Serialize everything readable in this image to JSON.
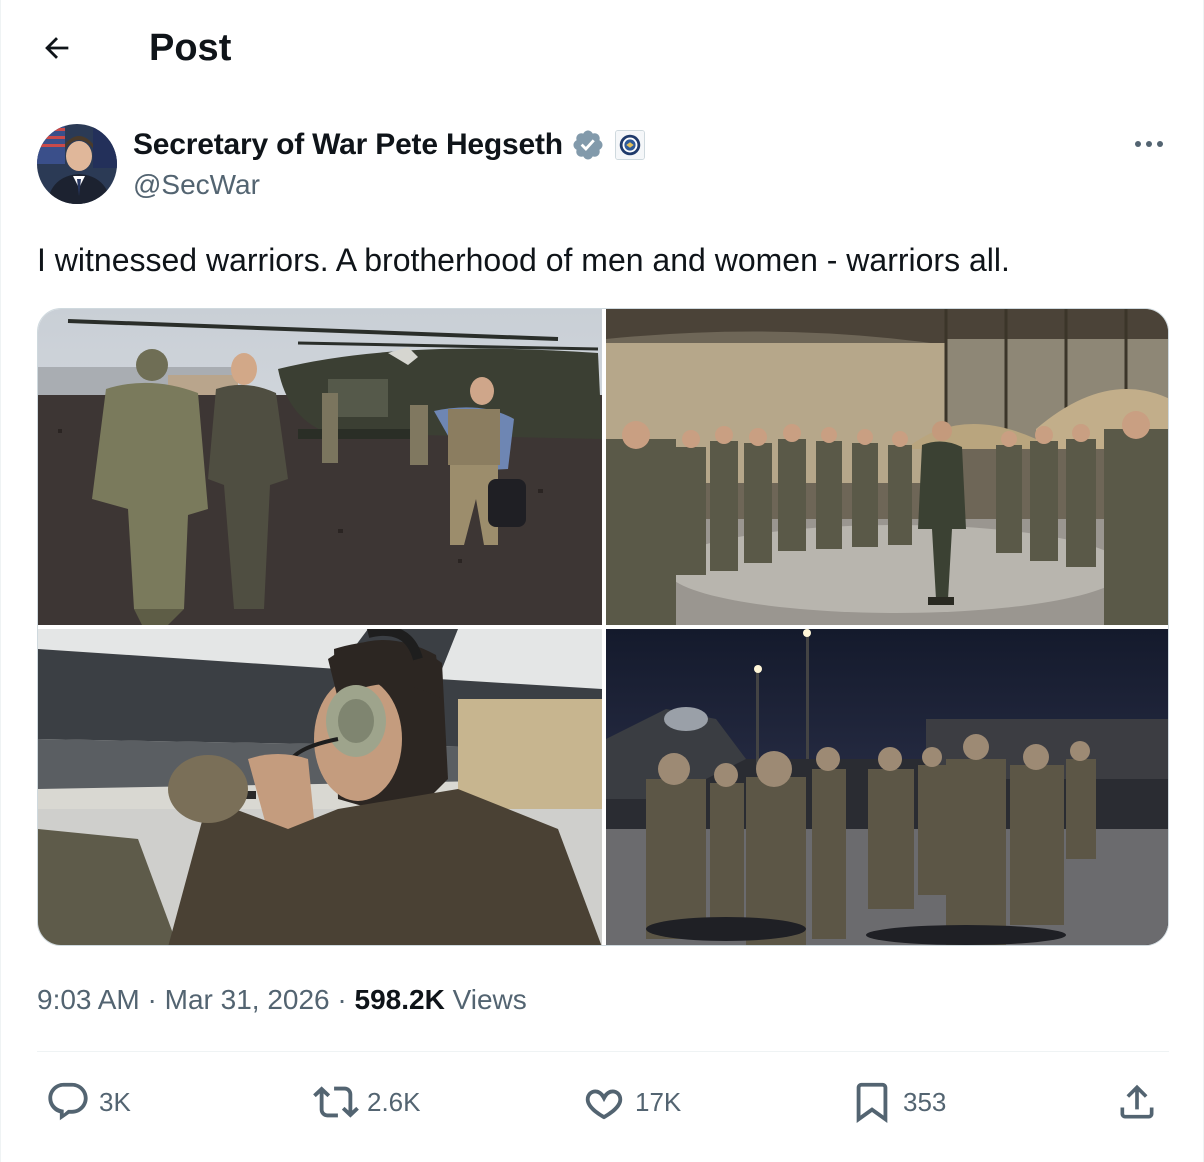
{
  "header": {
    "title": "Post"
  },
  "author": {
    "display_name": "Secretary of War Pete Hegseth",
    "handle": "@SecWar"
  },
  "post": {
    "text": "I witnessed warriors. A brotherhood of men and women - warriors all."
  },
  "meta": {
    "time": "9:03 AM",
    "separator": " · ",
    "date": "Mar 31, 2026",
    "views_count": "598.2K",
    "views_label": " Views"
  },
  "actions": {
    "replies": "3K",
    "reposts": "2.6K",
    "likes": "17K",
    "bookmarks": "353"
  },
  "colors": {
    "verified_badge": "#829aab",
    "secondary_text": "#536471",
    "primary_text": "#0f1419",
    "border": "#cfd9de"
  },
  "icons": {
    "back": "arrow-left-icon",
    "more": "more-horizontal-icon",
    "verified": "verified-badge-icon",
    "affiliation": "department-seal-icon",
    "reply": "speech-bubble-icon",
    "repost": "repost-arrows-icon",
    "like": "heart-icon",
    "bookmark": "bookmark-icon",
    "share": "share-upload-icon"
  }
}
